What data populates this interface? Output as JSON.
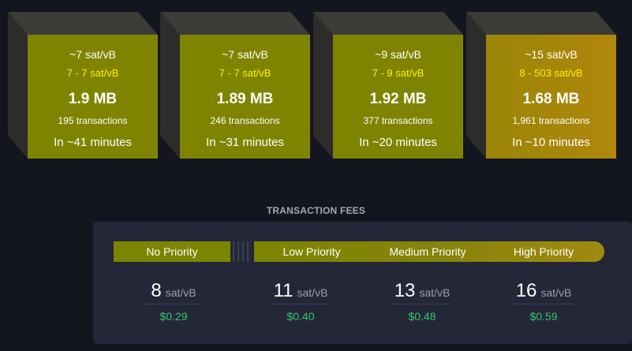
{
  "blocks": [
    {
      "median_fee": "~7 sat/vB",
      "fee_range": "7 - 7 sat/vB",
      "size": "1.9 MB",
      "transactions": "195 transactions",
      "eta": "In ~41 minutes",
      "color": "#7f8400"
    },
    {
      "median_fee": "~7 sat/vB",
      "fee_range": "7 - 7 sat/vB",
      "size": "1.89 MB",
      "transactions": "246 transactions",
      "eta": "In ~31 minutes",
      "color": "#7f8400"
    },
    {
      "median_fee": "~9 sat/vB",
      "fee_range": "7 - 9 sat/vB",
      "size": "1.92 MB",
      "transactions": "377 transactions",
      "eta": "In ~20 minutes",
      "color": "#7f8400"
    },
    {
      "median_fee": "~15 sat/vB",
      "fee_range": "8 - 503 sat/vB",
      "size": "1.68 MB",
      "transactions": "1,961 transactions",
      "eta": "In ~10 minutes",
      "color": "#b0870b"
    }
  ],
  "fees": {
    "title": "TRANSACTION FEES",
    "unit": "sat/vB",
    "priorities": [
      {
        "label": "No Priority",
        "value": "8",
        "usd": "$0.29"
      },
      {
        "label": "Low Priority",
        "value": "11",
        "usd": "$0.40"
      },
      {
        "label": "Medium Priority",
        "value": "13",
        "usd": "$0.48"
      },
      {
        "label": "High Priority",
        "value": "16",
        "usd": "$0.59"
      }
    ]
  },
  "colors": {
    "background": "#13151f",
    "panel": "#242737",
    "accent_yellow": "#fff000",
    "usd_green": "#2fc96a"
  }
}
